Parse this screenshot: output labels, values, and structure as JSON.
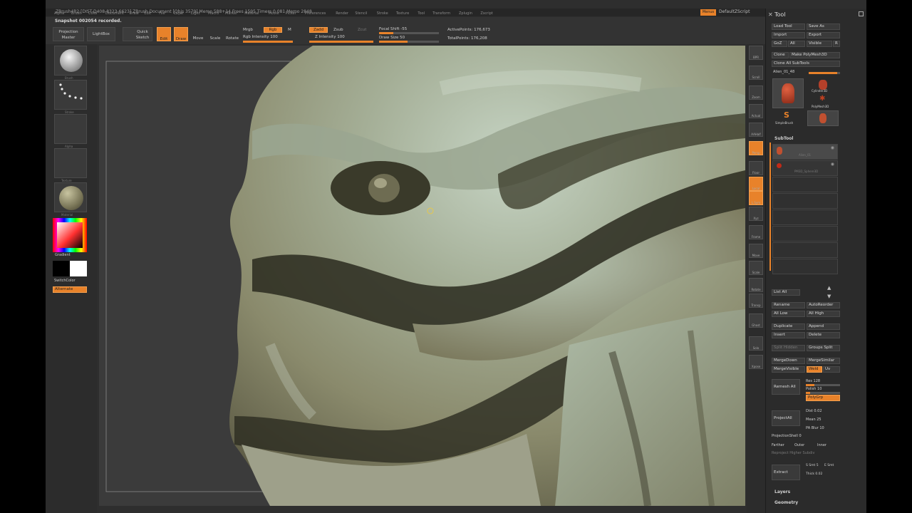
{
  "window": {
    "title": "ZBrush4R2 [DIST-D408-8323-6623]   ZBrush Document   [Objs 3579] Memo 588+14 Frees 1595 Timers 0.081 Memo 2848",
    "menu_button": "Menus",
    "script": "DefaultZScript",
    "controls": "– □ ×"
  },
  "menus": [
    "Alpha",
    "Brush",
    "Color",
    "Document",
    "Draw",
    "Edit",
    "File",
    "Layer",
    "Light",
    "Macro",
    "Marker",
    "Material",
    "Movie",
    "Picker",
    "Preferences",
    "Render",
    "Stencil",
    "Stroke",
    "Texture",
    "Tool",
    "Transform",
    "Zplugin",
    "Zscript"
  ],
  "topbar": {
    "notice": "Snapshot 002054 recorded.",
    "projection_master": "Projection Master",
    "lightbox": "LightBox",
    "quick_sketch": "Quick Sketch",
    "edit": "Edit",
    "draw": "Draw",
    "move": "Move",
    "scale": "Scale",
    "rotate": "Rotate",
    "mrgb": "Mrgb",
    "rgb": "Rgb",
    "m": "M",
    "zadd": "Zadd",
    "zsub": "Zsub",
    "zcut": "Zcut",
    "rgb_intensity": "Rgb Intensity 100",
    "z_intensity": "Z Intensity 100",
    "focal_shift": "Focal Shift -55",
    "draw_size": "Draw Size 50",
    "active_points": "ActivePoints: 176,673",
    "total_points": "TotalPoints: 176,208"
  },
  "left_shelf": {
    "brush": "Brush",
    "stroke": "Stroke",
    "alpha": "Alpha",
    "texture": "Texture",
    "material": "Material",
    "gradient": "Gradient",
    "switch_color": "SwitchColor",
    "alternate": "Alternate"
  },
  "right_shelf": {
    "buttons": [
      "BPR",
      "Scroll",
      "Zoom",
      "Actual",
      "AAHalf",
      "Persp",
      "Floor",
      "Local",
      "L.Sym",
      "Xyz",
      "Frame",
      "Move",
      "Scale",
      "Rotate",
      "Transp",
      "Ghost",
      "Solo",
      "Xpose"
    ]
  },
  "tool_panel": {
    "title": "Tool",
    "load_tool": "Load Tool",
    "save_as": "Save As",
    "import": "Import",
    "export": "Export",
    "goz": "GoZ",
    "all": "All",
    "visible": "Visible",
    "r": "R",
    "clone": "Clone",
    "make_polymesh": "Make PolyMesh3D",
    "clone_all": "Clone All SubTools",
    "active_tool": "Alien_01_48",
    "tool_thumbs": [
      "Alien_01_48",
      "Cylinder3D",
      "PolyMesh3D",
      "SimpleBrush"
    ],
    "subtool_label": "SubTool",
    "subtools": [
      "Alien_01",
      "PM3D_Sphere3D"
    ],
    "list_all": "List All",
    "rename": "Rename",
    "auto_reorder": "AutoReorder",
    "all_low": "All Low",
    "all_high": "All High",
    "duplicate": "Duplicate",
    "append": "Append",
    "insert": "Insert",
    "delete": "Delete",
    "split_hidden": "Split Hidden",
    "groups_split": "Groups Split",
    "merge_down": "MergeDown",
    "merge_similar": "MergeSimilar",
    "merge_visible": "MergeVisible",
    "weld": "Weld",
    "uv": "Uv",
    "remesh_all": "Remesh All",
    "res": "Res 128",
    "polish": "Polish 10",
    "polygrp": "PolyGrp",
    "project_all": "ProjectAll",
    "dist": "Dist 0.02",
    "mean": "Mean 25",
    "pa_blur": "PA Blur 10",
    "projection_shell": "ProjectionShell 0",
    "farther": "Farther",
    "outer": "Outer",
    "inner": "Inner",
    "reproject_higher": "Reproject Higher Subdiv",
    "extract": "Extract",
    "s_smt": "S Smt 5",
    "e_smt": "E Smt",
    "thick": "Thick 0.02",
    "layers": "Layers",
    "geometry": "Geometry"
  },
  "colors": {
    "accent": "#e8822a",
    "panel": "#2b2b2b",
    "canvas": "#3b3b3b",
    "sculpt_light": "#b8c8b8",
    "sculpt_mid": "#8a8c70",
    "sculpt_dark": "#2a2a1e"
  }
}
